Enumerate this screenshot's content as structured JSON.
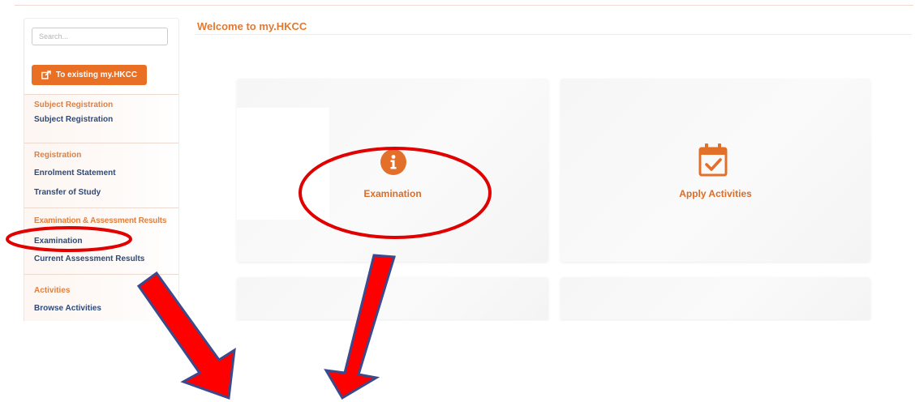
{
  "header": {
    "title": "Welcome to my.HKCC"
  },
  "sidebar": {
    "search_placeholder": "Search...",
    "existing_button_label": "To existing my.HKCC",
    "sections": [
      {
        "title": "Subject Registration",
        "items": [
          "Subject Registration"
        ]
      },
      {
        "title": "Registration",
        "items": [
          "Enrolment Statement",
          "Transfer of Study"
        ]
      },
      {
        "title": "Examination & Assessment Results",
        "items": [
          "Examination",
          "Current Assessment Results"
        ]
      },
      {
        "title": "Activities",
        "items": [
          "Browse Activities"
        ]
      }
    ]
  },
  "main": {
    "tiles": [
      {
        "label": "Examination",
        "icon": "info-circle-icon"
      },
      {
        "label": "Apply Activities",
        "icon": "calendar-check-icon"
      }
    ]
  },
  "colors": {
    "accent": "#e96f25",
    "link": "#2e4a7a",
    "annotation_red": "#e00000",
    "arrow_outline": "#3b4a8c"
  }
}
